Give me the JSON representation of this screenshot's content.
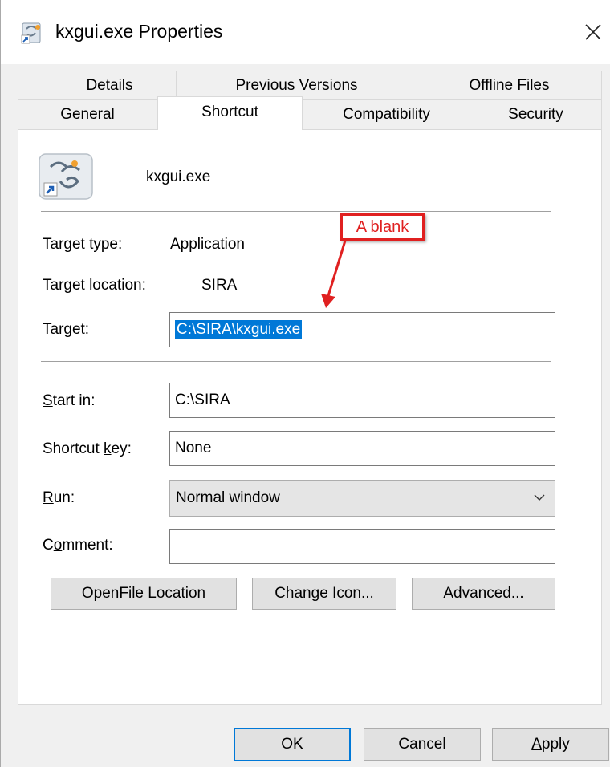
{
  "window": {
    "title": "kxgui.exe Properties",
    "close_glyph": "×",
    "title_icon": "shortcut-document-icon"
  },
  "tabs": {
    "row_back": [
      {
        "label": "Details"
      },
      {
        "label": "Previous Versions"
      },
      {
        "label": "Offline Files"
      }
    ],
    "row_front": [
      {
        "label": "General"
      },
      {
        "label": "Shortcut"
      },
      {
        "label": "Compatibility"
      },
      {
        "label": "Security"
      }
    ],
    "active": "Shortcut"
  },
  "shortcut": {
    "filename": "kxgui.exe",
    "app_icon": "kxgui-app-shortcut-icon",
    "target_type": {
      "label": "Target type:",
      "value": "Application"
    },
    "target_location": {
      "label": "Target location:",
      "value": "SIRA"
    },
    "target": {
      "label_accel": "T",
      "label_rest": "arget:",
      "value": "C:\\SIRA\\kxgui.exe"
    },
    "start_in": {
      "label_accel": "S",
      "label_rest": "tart in:",
      "value": "C:\\SIRA"
    },
    "shortcut_key": {
      "label_pre": "Shortcut ",
      "label_accel": "k",
      "label_rest": "ey:",
      "value": "None"
    },
    "run": {
      "label_accel": "R",
      "label_rest": "un:",
      "value": "Normal window"
    },
    "comment": {
      "label_pre": "C",
      "label_accel": "o",
      "label_rest": "mment:",
      "value": ""
    }
  },
  "buttons": {
    "open_file_location": {
      "pre": "Open ",
      "accel": "F",
      "rest": "ile Location"
    },
    "change_icon": {
      "pre": "",
      "accel": "C",
      "rest": "hange Icon..."
    },
    "advanced": {
      "pre": "A",
      "accel": "d",
      "rest": "vanced..."
    },
    "ok": "OK",
    "cancel": "Cancel",
    "apply": {
      "accel": "A",
      "rest": "pply"
    }
  },
  "annotation": {
    "text": "A blank",
    "color": "#e02020"
  },
  "colors": {
    "selection": "#0078d7",
    "default_button_border": "#0078d7"
  }
}
